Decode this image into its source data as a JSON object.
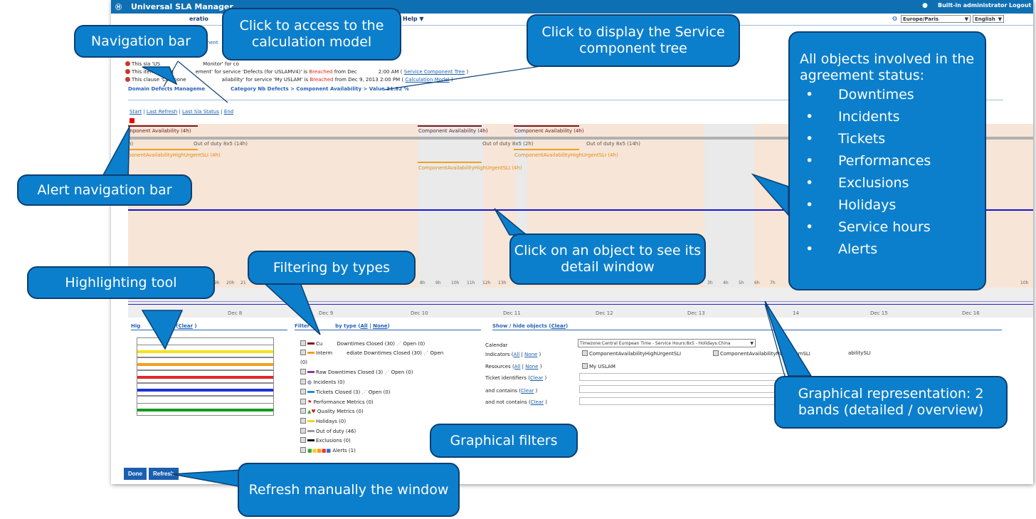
{
  "app": {
    "title": "Universal SLA Manager",
    "user": "Built-in administrator",
    "logout": "Logout",
    "timezone": "Europe/Paris",
    "language": "English"
  },
  "menu": {
    "visible_fragment": "eratio",
    "help": "Help ▼",
    "sub_fragment": "ement"
  },
  "status_lines": [
    {
      "prefix": "This sla 'US",
      "middle": "Monitor' for co",
      "suffix": ""
    },
    {
      "prefix": "This item 'Defect",
      "middle": "ement' for service 'Defects (for USLAMV4)' is ",
      "state": "Breached",
      "after": " from Dec",
      "time": "2:00 AM ( ",
      "link": "Service Component Tree",
      "end": " )"
    },
    {
      "prefix": "This clause 'Compone",
      "middle": "ailability' for service 'My USLAM' is ",
      "state": "Breached",
      "after": " from Dec 9, 2013 2:00 PM ( ",
      "link": "Calculation Model",
      "end": " )"
    }
  ],
  "breadcrumb": {
    "start": "Domain Defects Manageme",
    "end": "Category Nb Defects > Component Availability > Value 31.82 %"
  },
  "navlinks": [
    "Start",
    "Last Refresh",
    "Last Sla Status",
    "End"
  ],
  "timeline": {
    "bars": [
      {
        "label": "mponent Availability (4h)"
      },
      {
        "label": "Component Availability (4h)"
      },
      {
        "label": "Component Availability (4h)"
      }
    ],
    "outofduty": [
      "h)",
      "Out of duty 8x5 (14h)",
      "Out of duty 8x5 (2h)",
      "Out of duty 8x5 (14h)"
    ],
    "sli": [
      "ponentAvailabilityHighUrgentSLI (4h)",
      "ComponentAvailabilityHighUrgentSLI (4h)",
      "ComponentAvailabilityHighUrgentSLI (4h)"
    ],
    "hours": [
      "19h",
      "20h",
      "21",
      "8h",
      "9h",
      "10h",
      "11h",
      "12h",
      "13h",
      "3h",
      "4h",
      "5h",
      "6h",
      "7h",
      "10h"
    ],
    "days": [
      "Dec 8",
      "Dec 9",
      "Dec 10",
      "Dec 11",
      "Dec 12",
      "Dec 13",
      "14",
      "Dec 15",
      "Dec 16"
    ]
  },
  "highlight": {
    "title": "Hig",
    "title_end": "ts (",
    "clear": "Clear",
    "close": " )",
    "colors": [
      "#ffffff",
      "#f5e11c",
      "#ffffff",
      "#e2262c",
      "#1b31d6",
      "#ffffff",
      "#159a1b"
    ]
  },
  "filters": {
    "title_start": "Filter",
    "title_end": "by type (",
    "all": "All",
    "none": "None",
    "close": ")",
    "rows": [
      {
        "label": "Cu",
        "label2": "Downtimes Closed (30)",
        "open": "Open (0)"
      },
      {
        "label": "Interm",
        "label2": "ediate Downtimes Closed (30)",
        "open": "Open"
      },
      {
        "label": "(0)"
      },
      {
        "label": "Raw Downtimes Closed (3)",
        "open": "Open (0)"
      },
      {
        "label": "Incidents (0)"
      },
      {
        "label": "Tickets Closed (3)",
        "open": "Open (0)"
      },
      {
        "label": "Performance Metrics (0)"
      },
      {
        "label": "Quality Metrics (0)"
      },
      {
        "label": "Holidays (0)"
      },
      {
        "label": "Out of duty (46)"
      },
      {
        "label": "Exclusions (0)"
      },
      {
        "label": "Alerts (1)"
      }
    ]
  },
  "show": {
    "title": "Show / hide objects (",
    "clear": "Clear",
    "close": ")",
    "calendar_label": "Calendar",
    "calendar_value": "Timezone:Central European Time - Service Hours:8x5 - Holidays:China",
    "indicators_label": "Indicators (",
    "resources_label": "Resources (",
    "all": "All",
    "none": "None",
    "ticket_label": "Ticket identifiers (",
    "contains_label": "and contains (",
    "not_contains_label": "and not contains (",
    "indicators": [
      "ComponentAvailabilityHighUrgentSLI",
      "ComponentAvailabilityNbMediumSLI",
      "abilitySLI"
    ],
    "resource": "My USLAM"
  },
  "buttons": {
    "done": "Done",
    "refresh": "Refresh"
  },
  "callouts": {
    "navbar": "Navigation bar",
    "calc": "Click to access to the calculation model",
    "tree": "Click to display the Service component tree",
    "objects_title": "All objects involved in the agreement status:",
    "objects": [
      "Downtimes",
      "Incidents",
      "Tickets",
      "Performances",
      "Exclusions",
      "Holidays",
      "Service hours",
      "Alerts"
    ],
    "alertnav": "Alert navigation bar",
    "detail": "Click on an object to see its detail window",
    "filtering": "Filtering by types",
    "highlight": "Highlighting tool",
    "graphical": "Graphical representation: 2 bands (detailed / overview)",
    "gfilters": "Graphical filters",
    "refresh": "Refresh manually the window"
  },
  "colors": {
    "header": "#0f6fb3",
    "callout": "#0c7fcc",
    "callout_border": "#0a3f73",
    "timeline_bg": "#f7e5d7",
    "breached": "#dd2211",
    "link": "#1a5fb0"
  }
}
